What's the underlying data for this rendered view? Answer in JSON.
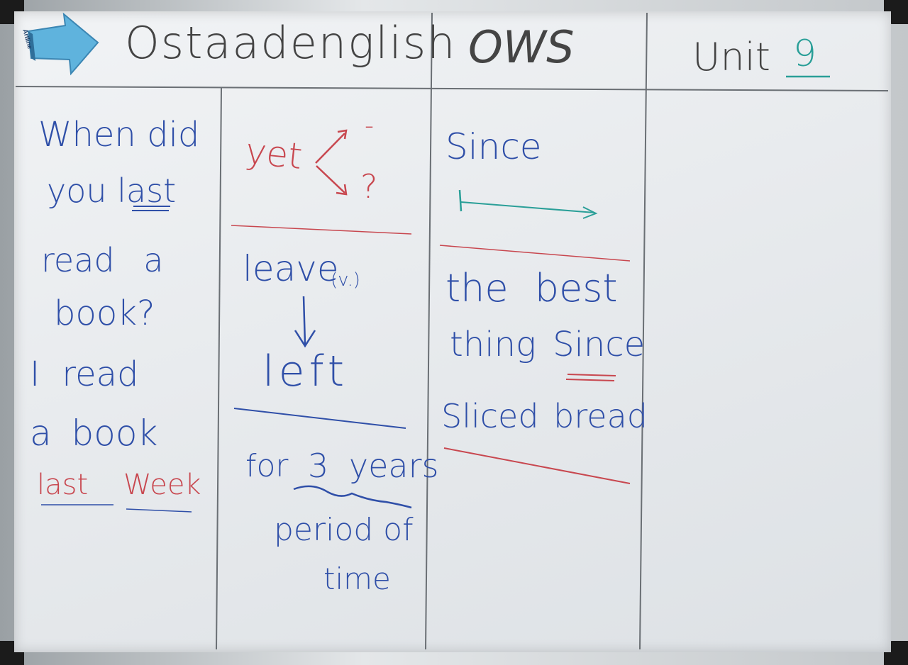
{
  "eraser": {
    "brand": "Artline"
  },
  "header": {
    "col1": "Ostaadenglish",
    "col2": "OWS",
    "col3_prefix": "Unit",
    "col3_number": "9"
  },
  "column1": {
    "lines": [
      "When did",
      "you last",
      "read a",
      "book?",
      "I read",
      "a book"
    ],
    "answer_red": "last",
    "answer_red2": "Week"
  },
  "column2": {
    "yet": "yet",
    "yet_minus": "-",
    "yet_question": "?",
    "leave": "leave",
    "leave_pos": "(v.)",
    "left": "left",
    "for": "for",
    "three_years": "3 years",
    "period1": "period of",
    "period2": "time"
  },
  "column3": {
    "since": "Since",
    "idiom1": "the best",
    "idiom2": "thing Since",
    "idiom3": "Sliced bread"
  },
  "colors": {
    "marker_blue": "#2f4fa8",
    "marker_red": "#c8474f",
    "marker_black": "#444444",
    "marker_teal": "#2a9f98",
    "eraser_blue": "#5fb3dd"
  }
}
